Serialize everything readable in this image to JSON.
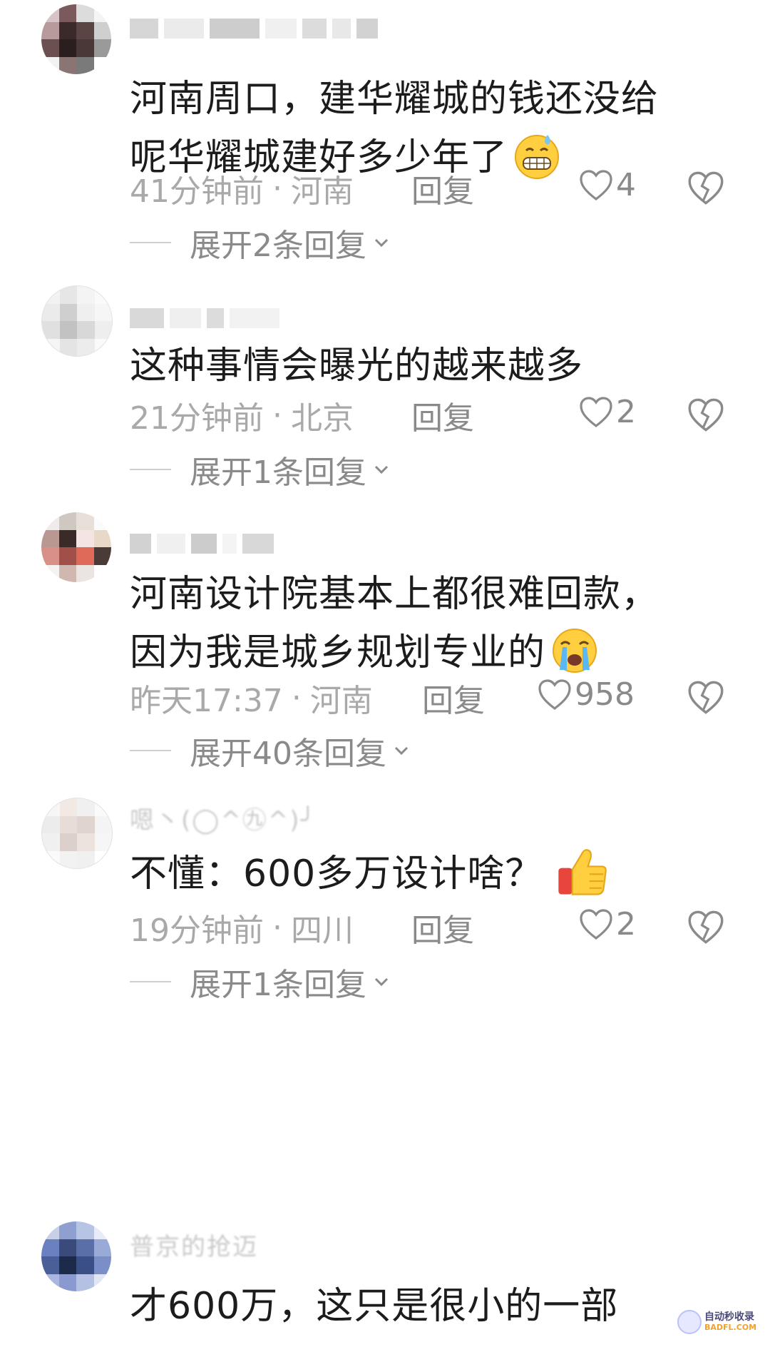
{
  "comments": [
    {
      "text_line1": "河南周口，建华耀城的钱还没给",
      "text_line2": "呢华耀城建好多少年了",
      "emoji": "grimacing-sweat-emoji",
      "time": "41分钟前",
      "location": "河南",
      "reply_label": "回复",
      "likes": "4",
      "expand_label": "展开2条回复"
    },
    {
      "text_line1": "这种事情会曝光的越来越多",
      "time": "21分钟前",
      "location": "北京",
      "reply_label": "回复",
      "likes": "2",
      "expand_label": "展开1条回复"
    },
    {
      "text_line1": "河南设计院基本上都很难回款，",
      "text_line2": "因为我是城乡规划专业的",
      "emoji": "crying-emoji",
      "time": "昨天17:37",
      "location": "河南",
      "reply_label": "回复",
      "likes": "958",
      "expand_label": "展开40条回复"
    },
    {
      "username": "嗯丶(◯^㊈^)╯",
      "text_line1": "不懂：600多万设计啥？",
      "emoji": "thumbs-up-emoji",
      "time": "19分钟前",
      "location": "四川",
      "reply_label": "回复",
      "likes": "2",
      "expand_label": "展开1条回复"
    },
    {
      "username": "普京的抢迈",
      "text_line1": "才600万，这只是很小的一部"
    }
  ],
  "separator": "·",
  "watermark": {
    "line1": "自动秒收录",
    "line2": "BADFL.COM"
  }
}
